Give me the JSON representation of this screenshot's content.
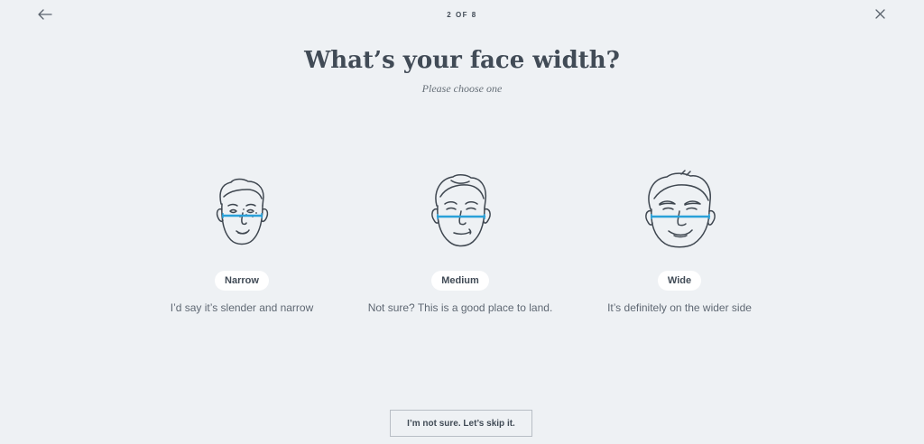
{
  "header": {
    "step": "2 OF 8",
    "back_icon": "arrow-left-icon",
    "close_icon": "close-icon"
  },
  "main": {
    "title": "What’s your face width?",
    "subtitle": "Please choose one",
    "options": [
      {
        "label": "Narrow",
        "description": "I’d say it’s slender and narrow",
        "icon": "narrow-face-icon"
      },
      {
        "label": "Medium",
        "description": "Not sure? This is a good place to land.",
        "icon": "medium-face-icon"
      },
      {
        "label": "Wide",
        "description": "It’s definitely on the wider side",
        "icon": "wide-face-icon"
      }
    ]
  },
  "footer": {
    "skip_label": "I’m not sure. Let’s skip it."
  },
  "colors": {
    "background": "#eef1f4",
    "text": "#414b56",
    "accent_line": "#2aa1d9",
    "pill_bg": "#ffffff"
  }
}
